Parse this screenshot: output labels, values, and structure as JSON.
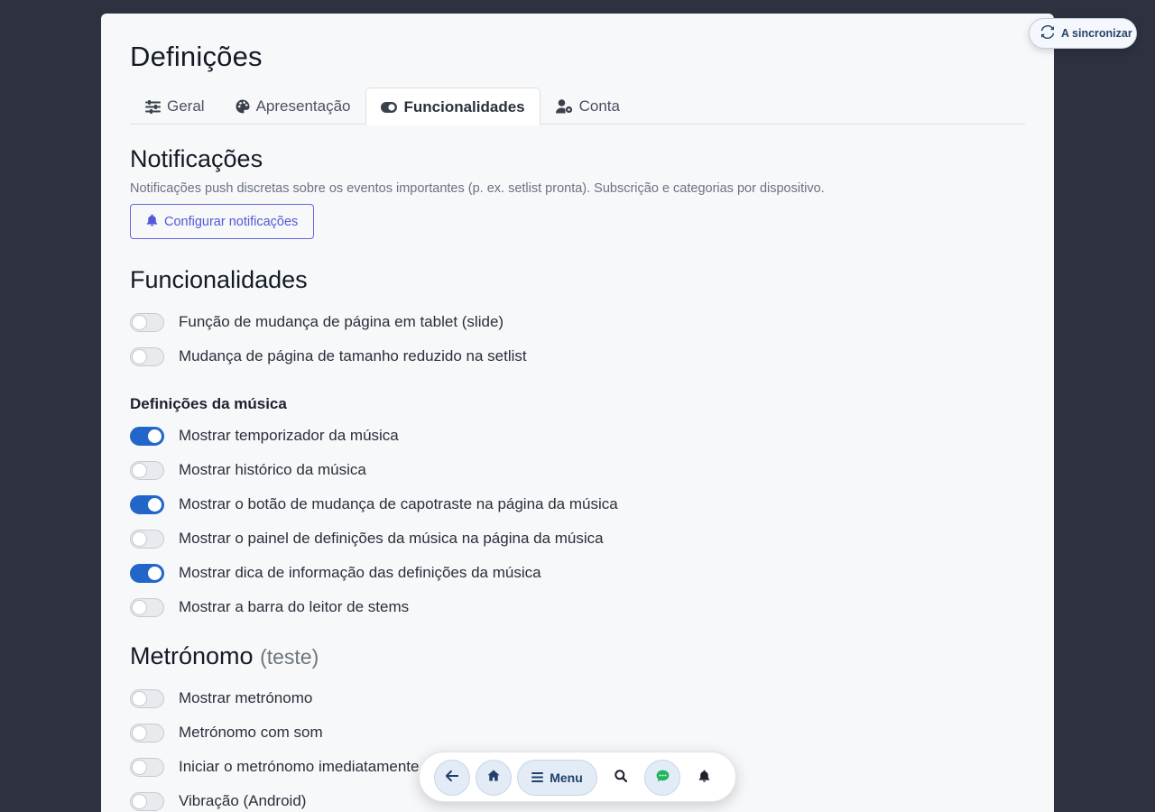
{
  "page": {
    "title": "Definições"
  },
  "tabs": [
    {
      "label": "Geral",
      "icon": "sliders-icon",
      "active": false
    },
    {
      "label": "Apresentação",
      "icon": "palette-icon",
      "active": false
    },
    {
      "label": "Funcionalidades",
      "icon": "toggle-icon",
      "active": true
    },
    {
      "label": "Conta",
      "icon": "user-gear-icon",
      "active": false
    }
  ],
  "notifications": {
    "title": "Notificações",
    "description": "Notificações push discretas sobre os eventos importantes (p. ex. setlist pronta). Subscrição e categorias por dispositivo.",
    "button_label": "Configurar notificações"
  },
  "features": {
    "title": "Funcionalidades",
    "toggles": [
      {
        "label": "Função de mudança de página em tablet (slide)",
        "on": false
      },
      {
        "label": "Mudança de página de tamanho reduzido na setlist",
        "on": false
      }
    ]
  },
  "song_settings": {
    "title": "Definições da música",
    "toggles": [
      {
        "label": "Mostrar temporizador da música",
        "on": true
      },
      {
        "label": "Mostrar histórico da música",
        "on": false
      },
      {
        "label": "Mostrar o botão de mudança de capotraste na página da música",
        "on": true
      },
      {
        "label": "Mostrar o painel de definições da música na página da música",
        "on": false
      },
      {
        "label": "Mostrar dica de informação das definições da música",
        "on": true
      },
      {
        "label": "Mostrar a barra do leitor de stems",
        "on": false
      }
    ]
  },
  "metronome": {
    "title": "Metrónomo",
    "badge": "(teste)",
    "toggles": [
      {
        "label": "Mostrar metrónomo",
        "on": false
      },
      {
        "label": "Metrónomo com som",
        "on": false
      },
      {
        "label": "Iniciar o metrónomo imediatamente",
        "on": false
      },
      {
        "label": "Vibração (Android)",
        "on": false
      }
    ]
  },
  "sync": {
    "label": "A sincronizar",
    "icon": "sync-icon"
  },
  "bottom_nav": {
    "menu_label": "Menu",
    "items": [
      "back-arrow-icon",
      "home-icon",
      "menu-icon",
      "search-icon",
      "chat-icon",
      "bell-icon"
    ]
  },
  "colors": {
    "background": "#2d3140",
    "card": "#f6f8fa",
    "toggle_on": "#2166c8",
    "accent_outline": "#6366e0",
    "chat_green": "#22b45e"
  }
}
